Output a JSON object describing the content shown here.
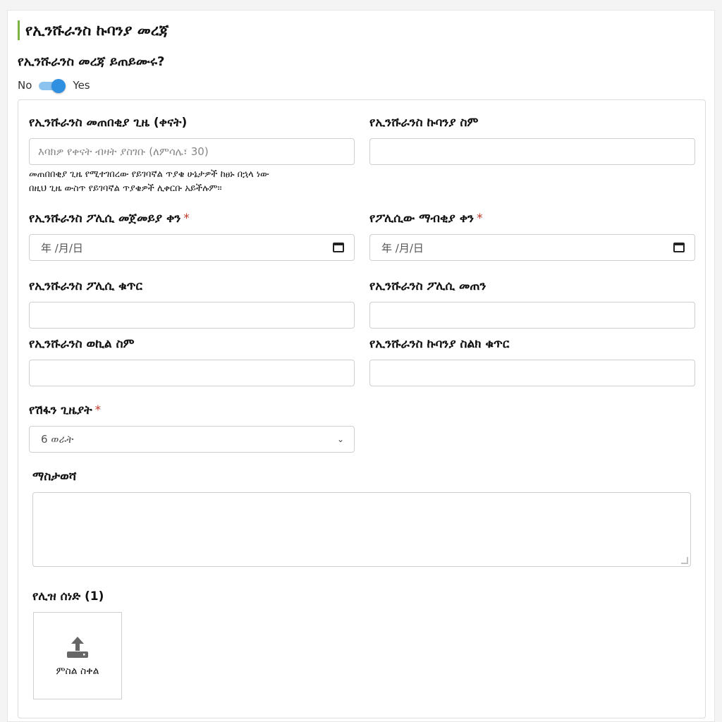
{
  "section": {
    "title": "የኢንሹራንስ ኩባንያ መረጃ"
  },
  "question": {
    "text": "የኢንሹራንስ መረጃ ይጠይሙሩ?"
  },
  "toggle": {
    "off_label": "No",
    "on_label": "Yes",
    "value": true
  },
  "form": {
    "waiting_period": {
      "label": "የኢንሹራንስ መጠበቂያ ጊዜ (ቀናት)",
      "placeholder": "እባክዎ የቀናት ብዛት ያስገቡ (ለምሳሌ፣ 30)",
      "help_line1": "መጠበበቂያ ጊዜ የሚተገበረው የይገባኛል ጥያቄ ሁኔታዎች ከፀኑ በኋላ ነው",
      "help_line2": "በዚህ ጊዜ ውስጥ የይገባኛል ጥያቄዎች ሊቀርቡ አይችሉም።"
    },
    "company_name": {
      "label": "የኢንሹራንስ ኩባንያ ስም"
    },
    "policy_start": {
      "label": "የኢንሹራንስ ፖሊሲ መጀመይያ ቀን",
      "required": "*",
      "placeholder": "年 /月/日"
    },
    "policy_end": {
      "label": "የፖሊሲው ማብቂያ ቀን",
      "required": "*",
      "placeholder": "年 /月/日"
    },
    "policy_number": {
      "label": "የኢንሹራንስ ፖሊሲ ቁጥር"
    },
    "policy_amount": {
      "label": "የኢንሹራንስ ፖሊሲ መጠን"
    },
    "agent_name": {
      "label": "የኢንሹራንስ ወኪል ስም"
    },
    "company_phone": {
      "label": "የኢንሹራንስ ኩባንያ ስልክ ቁጥር"
    },
    "coverage_period": {
      "label": "የሽፋን ጊዜያት",
      "required": "*",
      "selected": "6 ወራት"
    },
    "notes": {
      "label": "ማስታወሻ"
    },
    "license_doc": {
      "label": "የሊዝ ሰነድ (1)",
      "upload_label": "ምስል ስቀል"
    }
  },
  "colors": {
    "accent_bar": "#7cb342",
    "toggle": "#2f8fe0",
    "required": "#c0392b"
  },
  "icons": {
    "date": "calendar-icon",
    "select": "chevron-down-icon",
    "upload": "upload-icon"
  }
}
